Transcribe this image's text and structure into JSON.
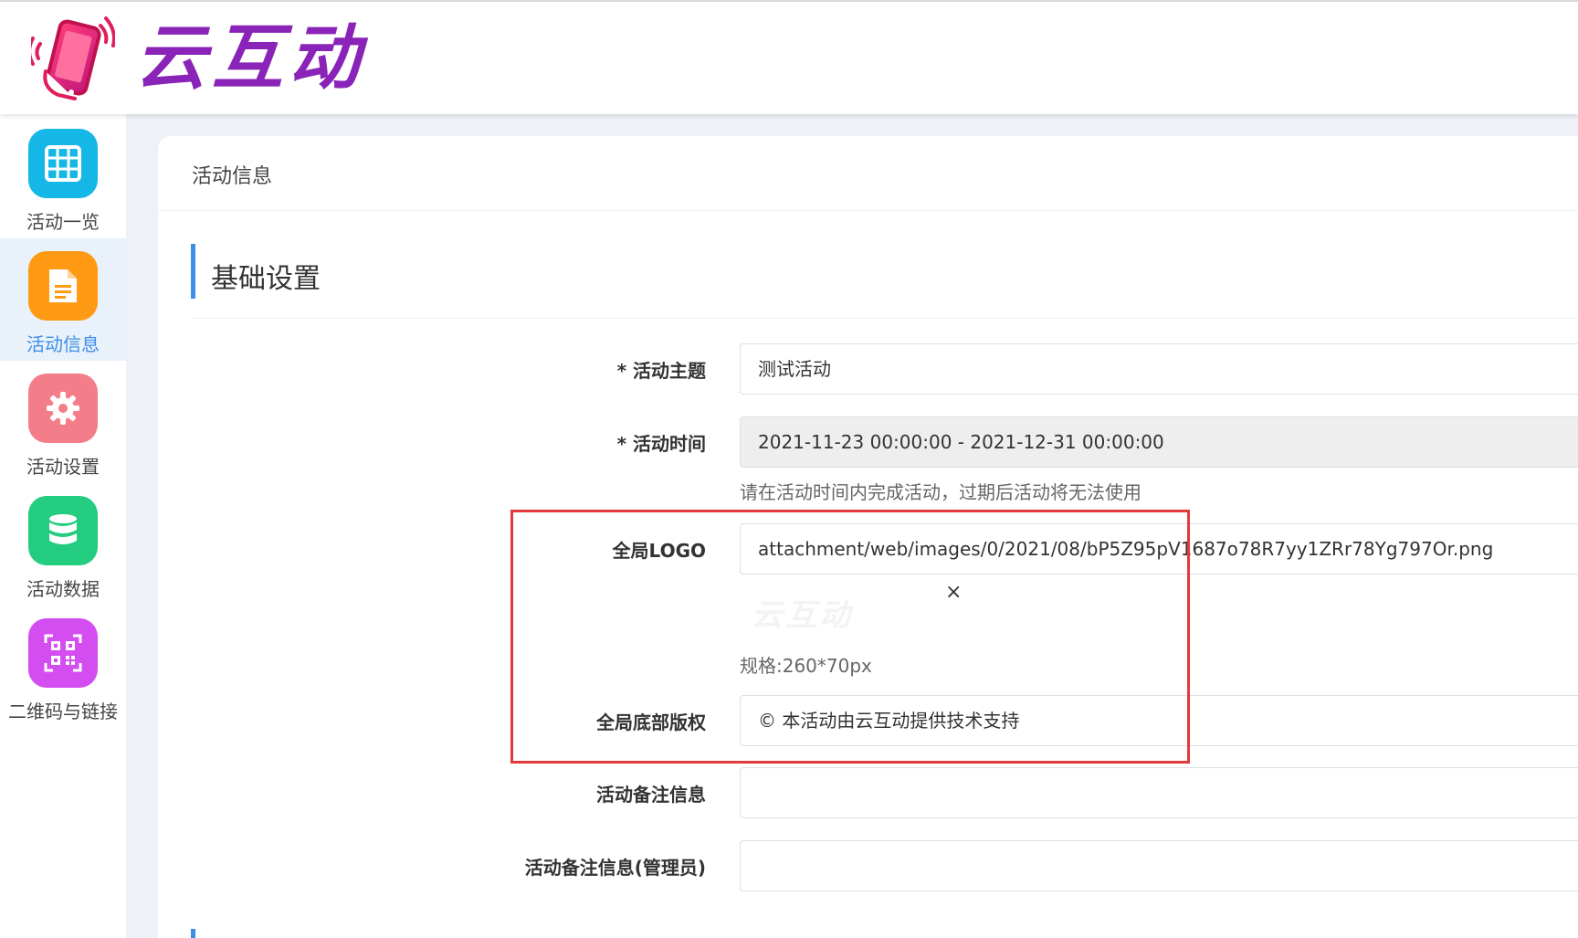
{
  "header": {
    "brand_name": "云互动"
  },
  "sidebar": {
    "items": [
      {
        "label": "活动一览",
        "icon": "grid-icon",
        "color": "#15b7e6",
        "active": false
      },
      {
        "label": "活动信息",
        "icon": "document-icon",
        "color": "#ff9a14",
        "active": true
      },
      {
        "label": "活动设置",
        "icon": "gear-icon",
        "color": "#f47d8a",
        "active": false
      },
      {
        "label": "活动数据",
        "icon": "database-icon",
        "color": "#23cc7f",
        "active": false
      },
      {
        "label": "二维码与链接",
        "icon": "qrcode-icon",
        "color": "#d44df1",
        "active": false
      }
    ]
  },
  "page": {
    "title": "活动信息",
    "section_title": "基础设置"
  },
  "form": {
    "subject": {
      "label": "* 活动主题",
      "value": "测试活动"
    },
    "time": {
      "label": "* 活动时间",
      "value": "2021-11-23 00:00:00 - 2021-12-31 00:00:00",
      "hint": "请在活动时间内完成活动，过期后活动将无法使用"
    },
    "logo": {
      "label": "全局LOGO",
      "value": "attachment/web/images/0/2021/08/bP5Z95pV1687o78R7yy1ZRr78Yg797Or.png",
      "close": "×",
      "preview_text": "云互动",
      "spec": "规格:260*70px"
    },
    "copyright": {
      "label": "全局底部版权",
      "value": "© 本活动由云互动提供技术支持"
    },
    "remark": {
      "label": "活动备注信息",
      "value": ""
    },
    "remark_admin": {
      "label": "活动备注信息(管理员)",
      "value": ""
    }
  },
  "colors": {
    "accent": "#3d8ee8",
    "highlight": "#e03a3a",
    "brand": "#8a24b8"
  }
}
